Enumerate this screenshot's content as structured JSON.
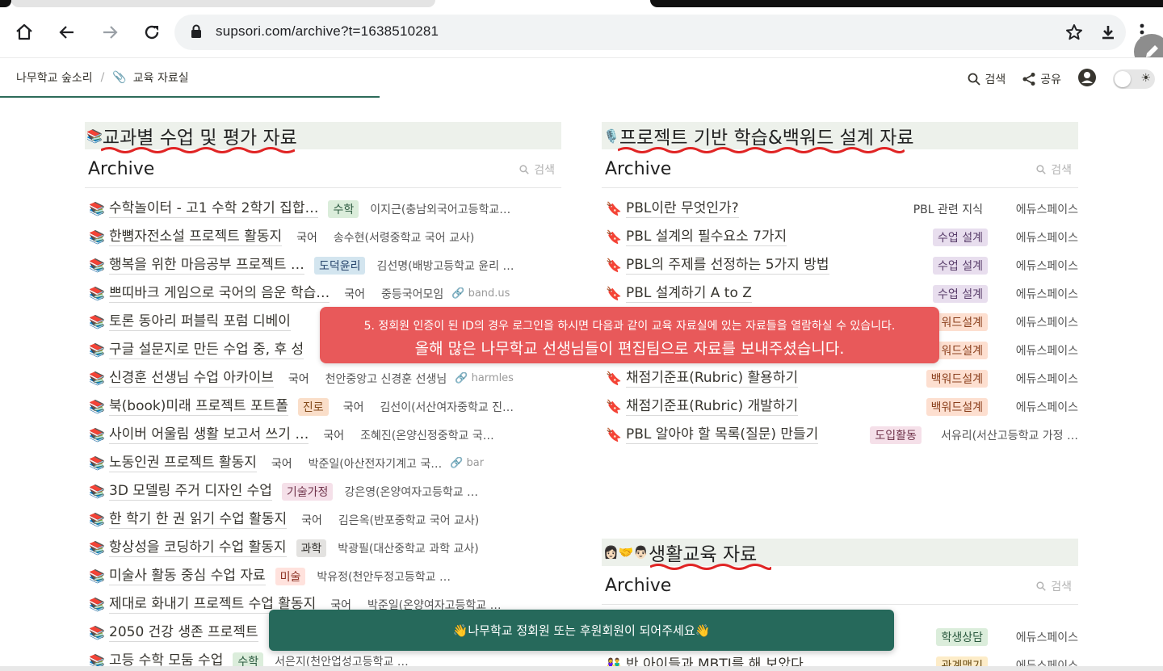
{
  "browser": {
    "url": "supsori.com/archive?t=1638510281"
  },
  "header": {
    "breadcrumb_root": "나무학교 숲소리",
    "breadcrumb_sep": "/",
    "breadcrumb_icon": "📎",
    "breadcrumb_page": "교육 자료실",
    "search_label": "검색",
    "share_label": "공유"
  },
  "left": {
    "heading_icon": "📚",
    "heading": "교과별 수업 및 평가 자료",
    "archive_title": "Archive",
    "search_placeholder": "검색",
    "items": [
      {
        "icon": "📚",
        "title": "수학놀이터 - 고1 수학 2학기 집합…",
        "tag": "수학",
        "author": "이지근(충남외국어고등학교…",
        "link": ""
      },
      {
        "icon": "📚",
        "title": "한뼘자전소설 프로젝트 활동지",
        "tag": "국어",
        "author": "송수현(서령중학교 국어 교사)",
        "link": ""
      },
      {
        "icon": "📚",
        "title": "행복을 위한 마음공부 프로젝트 …",
        "tag": "도덕윤리",
        "author": "김선명(배방고등학교 윤리 …",
        "link": ""
      },
      {
        "icon": "📚",
        "title": "쁘띠바크 게임으로 국어의 음운 학습…",
        "tag": "국어",
        "author": "중등국어모임",
        "link": "band.us"
      },
      {
        "icon": "📚",
        "title": "토론 동아리 퍼블릭 포럼 디베이",
        "tag": "",
        "author": "",
        "link": ""
      },
      {
        "icon": "📚",
        "title": "구글 설문지로 만든 수업 중, 후 성",
        "tag": "",
        "author": "",
        "link": ""
      },
      {
        "icon": "📚",
        "title": "신경훈 선생님 수업 아카이브",
        "tag": "국어",
        "author": "천안중앙고 신경훈 선생님",
        "link": "harmles"
      },
      {
        "icon": "📚",
        "title": "북(book)미래 프로젝트 포트폴",
        "tag": "진로",
        "tag2": "국어",
        "author": "김선이(서산여자중학교 진…",
        "link": ""
      },
      {
        "icon": "📚",
        "title": "사이버 어울림 생활 보고서 쓰기 …",
        "tag": "국어",
        "author": "조혜진(온양신정중학교 국…",
        "link": ""
      },
      {
        "icon": "📚",
        "title": "노동인권 프로젝트 활동지",
        "tag": "국어",
        "author": "박준일(아산전자기계고 국…",
        "link": "bar"
      },
      {
        "icon": "📚",
        "title": "3D 모델링 주거 디자인 수업",
        "tag": "기술가정",
        "author": "강은영(온양여자고등학교 …",
        "link": ""
      },
      {
        "icon": "📚",
        "title": "한 학기 한 권 읽기 수업 활동지",
        "tag": "국어",
        "author": "김은옥(반포중학교 국어 교사)",
        "link": ""
      },
      {
        "icon": "📚",
        "title": "항상성을 코딩하기 수업 활동지",
        "tag": "과학",
        "author": "박광필(대산중학교 과학 교사)",
        "link": ""
      },
      {
        "icon": "📚",
        "title": "미술사 활동 중심 수업 자료",
        "tag": "미술",
        "author": "박유정(천안두정고등학교 …",
        "link": ""
      },
      {
        "icon": "📚",
        "title": "제대로 화내기 프로젝트 수업 활동지",
        "tag": "국어",
        "author": "박준일(온양여자고등학교 …",
        "link": ""
      },
      {
        "icon": "📚",
        "title": "2050 건강 생존 프로젝트",
        "tag": "",
        "author": "",
        "link": ""
      },
      {
        "icon": "📚",
        "title": "고등 수학 모둠 수업",
        "tag": "수학",
        "author": "서은지(천안업성고등학교 …",
        "link": ""
      }
    ]
  },
  "right": {
    "heading_icon": "🎙️",
    "heading": "프로젝트 기반 학습&백워드 설계 자료",
    "archive_title": "Archive",
    "search_placeholder": "검색",
    "items": [
      {
        "icon": "🔖",
        "title": "PBL이란 무엇인가?",
        "tag": "PBL 관련 지식",
        "author": "에듀스페이스"
      },
      {
        "icon": "🔖",
        "title": "PBL 설계의 필수요소 7가지",
        "tag": "수업 설계",
        "author": "에듀스페이스"
      },
      {
        "icon": "🔖",
        "title": "PBL의 주제를 선정하는 5가지 방법",
        "tag": "수업 설계",
        "author": "에듀스페이스"
      },
      {
        "icon": "🔖",
        "title": "PBL 설계하기 A to Z",
        "tag": "수업 설계",
        "author": "에듀스페이스"
      },
      {
        "icon": "🔖",
        "title": "",
        "tag": "워드설계",
        "author": "에듀스페이스"
      },
      {
        "icon": "🔖",
        "title": "",
        "tag": "워드설계",
        "author": "에듀스페이스"
      },
      {
        "icon": "🔖",
        "title": "채점기준표(Rubric) 활용하기",
        "tag": "백워드설계",
        "author": "에듀스페이스"
      },
      {
        "icon": "🔖",
        "title": "채점기준표(Rubric) 개발하기",
        "tag": "백워드설계",
        "author": "에듀스페이스"
      },
      {
        "icon": "🔖",
        "title": "PBL 알아야 할 목록(질문) 만들기",
        "tag": "도입활동",
        "author": "서유리(서산고등학교 가정 …"
      }
    ],
    "life": {
      "heading_icon": "👩🏻🤝👨🏻",
      "heading": "생활교육 자료",
      "archive_title": "Archive",
      "search_placeholder": "검색",
      "items": [
        {
          "icon": "",
          "title": "",
          "tag": "학생상담",
          "author": "에듀스페이스"
        },
        {
          "icon": "👫",
          "title": "반 아이들과 MBTI를 해 보았다",
          "tag": "관계맺기",
          "author": "에듀스페이스"
        }
      ]
    }
  },
  "banner": {
    "line1": "5. 정회원 인증이 된 ID의 경우 로그인을 하시면 다음과 같이 교육 자료실에 있는 자료들을 열람하실 수 있습니다.",
    "line2": "올해 많은 나무학교 선생님들이 편집팀으로 자료를 보내주셨습니다."
  },
  "toast": {
    "text": "👋나무학교 정회원 또는 후원회원이 되어주세요👋"
  },
  "colors": {
    "banner_red": "#e8595a",
    "toast_green": "#26695b",
    "heading_bg": "#edf1eb",
    "squiggle_red": "#e02424"
  }
}
